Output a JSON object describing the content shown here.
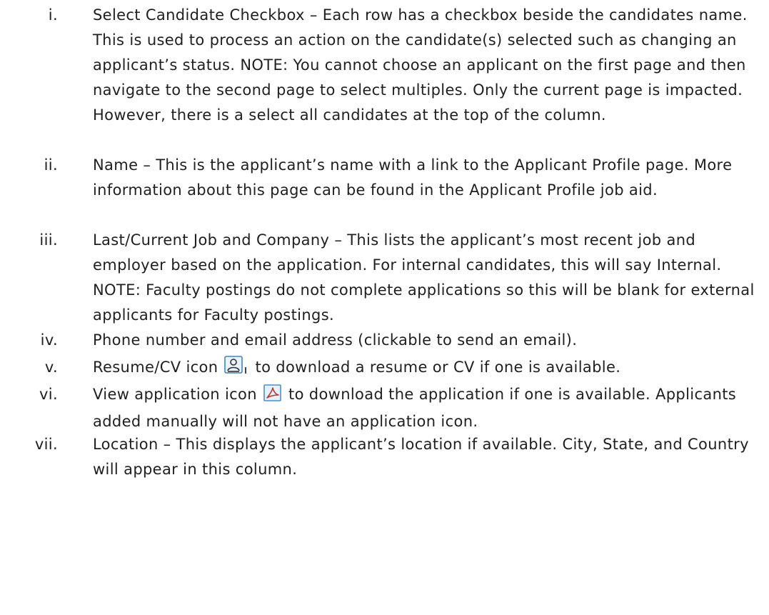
{
  "items": [
    {
      "numeral": "i.",
      "text": "Select Candidate Checkbox – Each row has a checkbox beside the candidates name. This is used to process an action on the candidate(s) selected such as changing an applicant’s status. NOTE: You cannot choose an applicant on the first page and then navigate to the second page to select multiples. Only the current page is impacted. However, there is a select all candidates at the top of the column."
    },
    {
      "numeral": "ii.",
      "text": "Name – This is the applicant’s name with a link to the Applicant Profile page. More information about this page can be found in the Applicant Profile job aid."
    },
    {
      "numeral": "iii.",
      "text": "Last/Current Job and Company – This lists the applicant’s most recent job and employer based on the application. For internal candidates, this will say Internal. NOTE: Faculty postings do not complete applications so this will be blank for external applicants for Faculty postings."
    },
    {
      "numeral": "iv.",
      "text": "Phone number and email address (clickable to send an email)."
    },
    {
      "numeral": "v.",
      "text_before": "Resume/CV icon",
      "icon": "resume-icon",
      "text_after": "to download a resume or CV if one is available."
    },
    {
      "numeral": "vi.",
      "text_before": "View application icon",
      "icon": "pdf-application-icon",
      "text_after": "to download the application if one is available. Applicants added manually will not have an application icon."
    },
    {
      "numeral": "vii.",
      "text": "Location – This displays the applicant’s location if available. City, State, and Country will appear in this column."
    }
  ]
}
